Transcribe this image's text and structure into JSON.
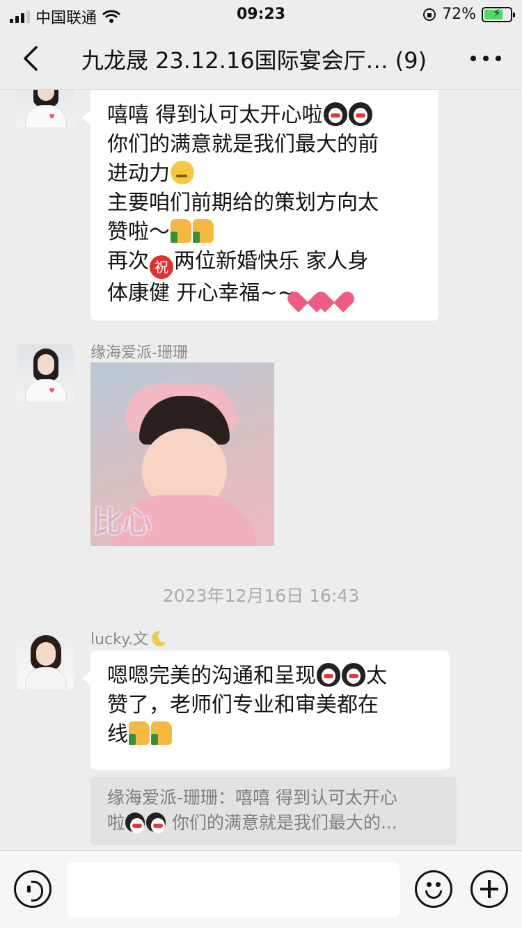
{
  "status_bar": {
    "carrier": "中国联通",
    "time": "09:23",
    "battery": "72%",
    "battery_level": 0.72
  },
  "header": {
    "title": "九龙晟 23.12.16国际宴会厅… (9)"
  },
  "messages": {
    "msg1": {
      "lines": [
        "嘻嘻 得到认可太开心啦",
        "你们的满意就是我们最大的前",
        "进动力",
        "主要咱们前期给的策划方向太",
        "赞啦～",
        "再次",
        "两位新婚快乐  家人身",
        "体康健  开心幸福~~"
      ],
      "zhu_char": "祝"
    },
    "msg2": {
      "sender": "缘海爱派-珊珊",
      "image_text": "比心"
    },
    "timestamp": "2023年12月16日 16:43",
    "msg3": {
      "sender": "lucky.文",
      "lines": [
        "嗯嗯完美的沟通和呈现",
        "太",
        "赞了，老师们专业和审美都在",
        "线"
      ],
      "quote_lines": [
        "缘海爱派-珊珊：嘻嘻 得到认可太开心",
        "啦",
        " 你们的满意就是我们最大的..."
      ]
    }
  },
  "icons": {
    "back": "chevron-left-icon",
    "more": "more-icon",
    "voice": "voice-icon",
    "emoji": "emoji-icon",
    "plus": "plus-icon"
  },
  "colors": {
    "background": "#ededed",
    "bubble": "#ffffff",
    "battery_fill": "#4cd964"
  }
}
